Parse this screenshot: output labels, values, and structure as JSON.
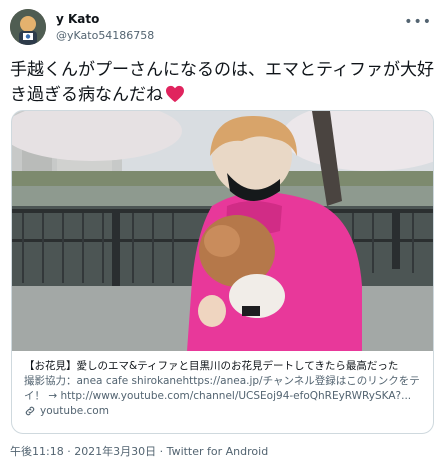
{
  "user": {
    "display_name": "y Kato",
    "handle": "@yKato54186758",
    "avatar_icon": "avatar-image"
  },
  "more_icon": "ellipsis-icon",
  "more_label": "•••",
  "tweet": {
    "text": "手越くんがプーさんになるのは、エマとティファが大好き過ぎる病なんだね",
    "emoji_icon": "red-heart-icon"
  },
  "card": {
    "title": "【お花見】愛しのエマ&ティファと目黒川のお花見デートしてきたら最高だった",
    "description": "撮影協力：anea cafe shirokanehttps://anea.jp/チャンネル登録はこのリンクをテイ！ → http://www.youtube.com/channel/UCSEoj94-efoQhREyRWRySKA?...",
    "domain": "youtube.com",
    "link_icon": "link-icon"
  },
  "meta": {
    "timestamp": "午後11:18 · 2021年3月30日 · Twitter for Android"
  },
  "colors": {
    "text": "#0f1419",
    "secondary": "#536471",
    "border": "#cfd9de",
    "hoodie": "#e8389a",
    "heart": "#e0245e"
  }
}
